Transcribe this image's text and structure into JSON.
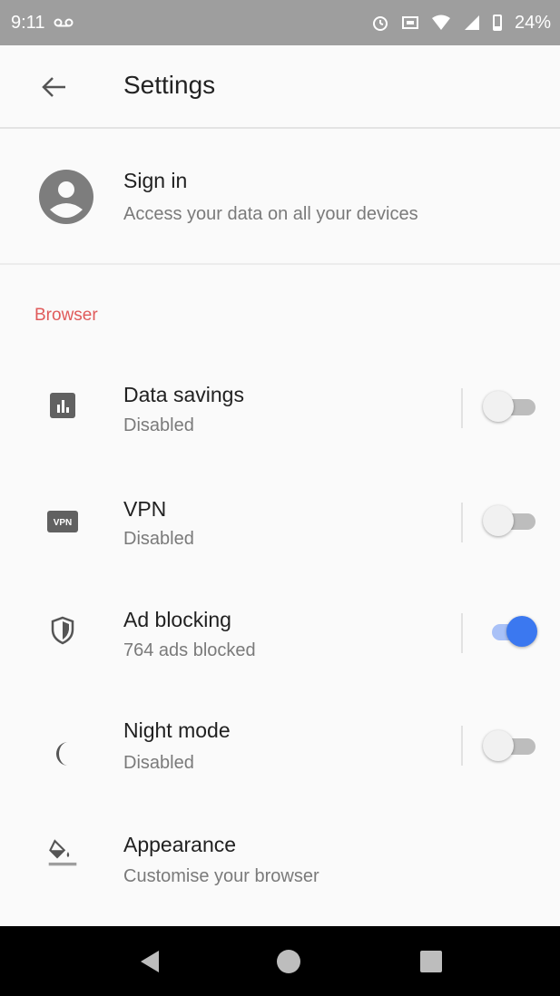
{
  "status_bar": {
    "time": "9:11",
    "voicemail_icon": "voicemail-icon",
    "battery_percent": "24%"
  },
  "app_bar": {
    "title": "Settings",
    "back_icon": "arrow-left-icon"
  },
  "sign_in": {
    "title": "Sign in",
    "subtitle": "Access your data on all your devices",
    "icon": "account-circle-icon"
  },
  "section_header": "Browser",
  "settings": [
    {
      "title": "Data savings",
      "subtitle": "Disabled",
      "icon": "bar-chart-icon",
      "toggle_on": false
    },
    {
      "title": "VPN",
      "subtitle": "Disabled",
      "icon": "vpn-icon",
      "icon_text": "VPN",
      "toggle_on": false
    },
    {
      "title": "Ad blocking",
      "subtitle": "764 ads blocked",
      "icon": "shield-icon",
      "toggle_on": true
    },
    {
      "title": "Night mode",
      "subtitle": "Disabled",
      "icon": "moon-icon",
      "toggle_on": false
    },
    {
      "title": "Appearance",
      "subtitle": "Customise your browser",
      "icon": "paint-bucket-icon"
    }
  ],
  "colors": {
    "accent": "#e05a5a",
    "toggle_on_thumb": "#3b78f0",
    "toggle_on_track": "#a9c1f7",
    "status_bar": "#9e9e9e"
  }
}
